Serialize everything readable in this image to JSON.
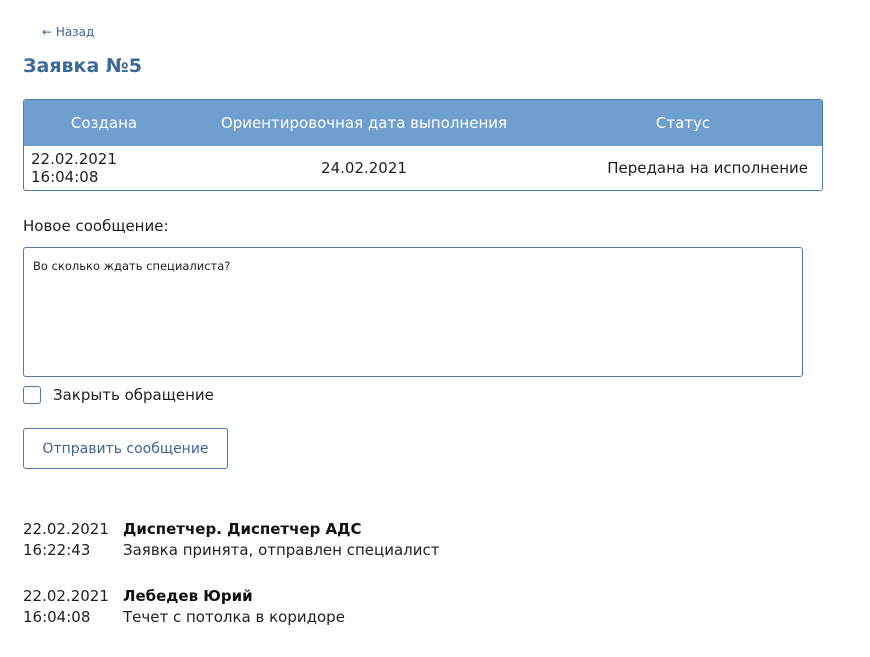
{
  "nav": {
    "back_label": "← Назад"
  },
  "page": {
    "title": "Заявка №5"
  },
  "info_table": {
    "headers": [
      "Создана",
      "Ориентировочная дата выполнения",
      "Статус"
    ],
    "row": {
      "created": "22.02.2021 16:04:08",
      "due_date": "24.02.2021",
      "status": "Передана на исполнение"
    }
  },
  "form": {
    "message_label": "Новое сообщение:",
    "message_value": "Во сколько ждать специалиста?",
    "close_label": "Закрыть обращение",
    "close_checked": false,
    "send_label": "Отправить сообщение"
  },
  "messages": [
    {
      "date": "22.02.2021",
      "time": "16:22:43",
      "author": "Диспетчер. Диспетчер АДС",
      "text": "Заявка принята, отправлен специалист"
    },
    {
      "date": "22.02.2021",
      "time": "16:04:08",
      "author": "Лебедев Юрий",
      "text": "Течет с потолка в коридоре"
    }
  ],
  "colors": {
    "accent": "#3c6a99",
    "table_header_bg": "#6f9fcf",
    "border": "#4d7ca8"
  }
}
